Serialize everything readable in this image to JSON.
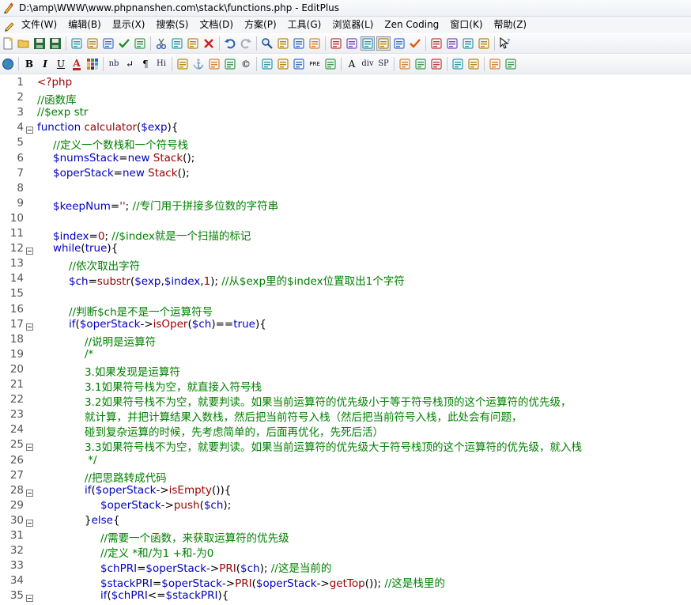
{
  "window": {
    "title": "D:\\amp\\WWW\\www.phpnanshen.com\\stack\\functions.php - EditPlus"
  },
  "menu": [
    {
      "label": "文件(W)"
    },
    {
      "label": "编辑(B)"
    },
    {
      "label": "显示(X)"
    },
    {
      "label": "搜索(S)"
    },
    {
      "label": "文档(D)"
    },
    {
      "label": "方案(P)"
    },
    {
      "label": "工具(G)"
    },
    {
      "label": "浏览器(L)"
    },
    {
      "label": "Zen Coding"
    },
    {
      "label": "窗口(K)"
    },
    {
      "label": "帮助(Z)"
    }
  ],
  "toolbar1": [
    {
      "icon": "new-file-icon"
    },
    {
      "icon": "open-folder-icon"
    },
    {
      "icon": "save-icon"
    },
    {
      "icon": "save-all-icon"
    },
    {
      "sep": true
    },
    {
      "icon": "print-preview-icon"
    },
    {
      "icon": "print-icon"
    },
    {
      "icon": "spell-check-icon"
    },
    {
      "icon": "check-icon"
    },
    {
      "icon": "ftp-upload-icon"
    },
    {
      "sep": true
    },
    {
      "icon": "cut-icon"
    },
    {
      "icon": "copy-icon"
    },
    {
      "icon": "paste-icon"
    },
    {
      "icon": "delete-icon"
    },
    {
      "sep": true
    },
    {
      "icon": "undo-icon"
    },
    {
      "icon": "redo-icon"
    },
    {
      "sep": true
    },
    {
      "icon": "find-icon"
    },
    {
      "icon": "replace-icon"
    },
    {
      "icon": "find-in-files-icon"
    },
    {
      "icon": "goto-line-icon"
    },
    {
      "sep": true
    },
    {
      "icon": "font-icon"
    },
    {
      "icon": "hex-icon"
    },
    {
      "icon": "word-wrap-icon"
    },
    {
      "icon": "line-number-icon"
    },
    {
      "icon": "column-select-icon"
    },
    {
      "icon": "spell-icon"
    },
    {
      "sep": true
    },
    {
      "icon": "window-icon"
    },
    {
      "icon": "tile-icon"
    },
    {
      "icon": "cliptext-icon"
    },
    {
      "icon": "dir-icon"
    },
    {
      "sep": true
    },
    {
      "icon": "help-cursor-icon"
    }
  ],
  "toolbar2": [
    {
      "icon": "globe-icon"
    },
    {
      "sep": true
    },
    {
      "icon": "bold-icon",
      "glyph": "B"
    },
    {
      "icon": "italic-icon",
      "glyph": "I"
    },
    {
      "icon": "underline-icon",
      "glyph": "U"
    },
    {
      "icon": "font-color-icon",
      "glyph": "A"
    },
    {
      "icon": "color-grid-icon"
    },
    {
      "sep": true
    },
    {
      "icon": "nbsp-icon",
      "glyph": "nb"
    },
    {
      "icon": "line-break-icon",
      "glyph": "↵"
    },
    {
      "icon": "paragraph-icon",
      "glyph": "¶"
    },
    {
      "icon": "heading-icon",
      "glyph": "Hi"
    },
    {
      "sep": true
    },
    {
      "icon": "image-icon"
    },
    {
      "icon": "anchor-icon",
      "glyph": "⚓"
    },
    {
      "icon": "hr-icon"
    },
    {
      "icon": "comment-icon"
    },
    {
      "icon": "copyright-icon",
      "glyph": "©"
    },
    {
      "sep": true
    },
    {
      "icon": "table-icon"
    },
    {
      "icon": "table-row-icon"
    },
    {
      "icon": "center-icon"
    },
    {
      "icon": "pre-icon",
      "glyph": "PRE"
    },
    {
      "icon": "list-icon"
    },
    {
      "sep": true
    },
    {
      "icon": "form-icon",
      "glyph": "A"
    },
    {
      "icon": "div-icon",
      "glyph": "div"
    },
    {
      "icon": "span-icon",
      "glyph": "SP"
    },
    {
      "sep": true
    },
    {
      "icon": "edit-icon"
    },
    {
      "icon": "style-icon"
    },
    {
      "icon": "script-icon"
    },
    {
      "sep": true
    },
    {
      "icon": "view-icon"
    },
    {
      "icon": "browser-icon"
    },
    {
      "sep": true
    },
    {
      "icon": "color-picker-icon"
    },
    {
      "icon": "preview-icon"
    }
  ],
  "code": {
    "lines": [
      {
        "n": "1",
        "fold": false,
        "indent": 0,
        "segs": [
          [
            "php",
            "<?php"
          ]
        ]
      },
      {
        "n": "2",
        "fold": false,
        "indent": 0,
        "segs": [
          [
            "cm",
            "//函数库"
          ]
        ]
      },
      {
        "n": "3",
        "fold": false,
        "indent": 0,
        "segs": [
          [
            "cm",
            "//$exp str"
          ]
        ]
      },
      {
        "n": "4",
        "fold": true,
        "indent": 0,
        "segs": [
          [
            "kw",
            "function "
          ],
          [
            "fn",
            "calculator"
          ],
          [
            "txt",
            "("
          ],
          [
            "var",
            "$exp"
          ],
          [
            "txt",
            "){"
          ]
        ]
      },
      {
        "n": "5",
        "fold": false,
        "indent": 1,
        "segs": [
          [
            "cm",
            "//定义一个数栈和一个符号栈"
          ]
        ]
      },
      {
        "n": "6",
        "fold": false,
        "indent": 1,
        "segs": [
          [
            "var",
            "$numsStack"
          ],
          [
            "txt",
            "="
          ],
          [
            "kw",
            "new "
          ],
          [
            "fn",
            "Stack"
          ],
          [
            "txt",
            "();"
          ]
        ]
      },
      {
        "n": "7",
        "fold": false,
        "indent": 1,
        "segs": [
          [
            "var",
            "$operStack"
          ],
          [
            "txt",
            "="
          ],
          [
            "kw",
            "new "
          ],
          [
            "fn",
            "Stack"
          ],
          [
            "txt",
            "();"
          ]
        ]
      },
      {
        "n": "8",
        "fold": false,
        "indent": 0,
        "segs": []
      },
      {
        "n": "9",
        "fold": false,
        "indent": 1,
        "segs": [
          [
            "var",
            "$keepNum"
          ],
          [
            "txt",
            "="
          ],
          [
            "fn",
            "''"
          ],
          [
            "txt",
            "; "
          ],
          [
            "cm",
            "//专门用于拼接多位数的字符串"
          ]
        ]
      },
      {
        "n": "10",
        "fold": false,
        "indent": 0,
        "segs": []
      },
      {
        "n": "11",
        "fold": false,
        "indent": 1,
        "segs": [
          [
            "var",
            "$index"
          ],
          [
            "txt",
            "="
          ],
          [
            "fn",
            "0"
          ],
          [
            "txt",
            "; "
          ],
          [
            "cm",
            "//$index就是一个扫描的标记"
          ]
        ]
      },
      {
        "n": "12",
        "fold": true,
        "indent": 1,
        "segs": [
          [
            "kw",
            "while"
          ],
          [
            "txt",
            "("
          ],
          [
            "kw",
            "true"
          ],
          [
            "txt",
            "){"
          ]
        ]
      },
      {
        "n": "13",
        "fold": false,
        "indent": 2,
        "segs": [
          [
            "cm",
            "//依次取出字符"
          ]
        ]
      },
      {
        "n": "14",
        "fold": false,
        "indent": 2,
        "segs": [
          [
            "var",
            "$ch"
          ],
          [
            "txt",
            "="
          ],
          [
            "fn",
            "substr"
          ],
          [
            "txt",
            "("
          ],
          [
            "var",
            "$exp"
          ],
          [
            "txt",
            ","
          ],
          [
            "var",
            "$index"
          ],
          [
            "txt",
            ","
          ],
          [
            "fn",
            "1"
          ],
          [
            "txt",
            "); "
          ],
          [
            "cm",
            "//从$exp里的$index位置取出1个字符"
          ]
        ]
      },
      {
        "n": "15",
        "fold": false,
        "indent": 0,
        "segs": []
      },
      {
        "n": "16",
        "fold": false,
        "indent": 2,
        "segs": [
          [
            "cm",
            "//判断$ch是不是一个运算符号"
          ]
        ]
      },
      {
        "n": "17",
        "fold": true,
        "indent": 2,
        "segs": [
          [
            "kw",
            "if"
          ],
          [
            "txt",
            "("
          ],
          [
            "var",
            "$operStack"
          ],
          [
            "txt",
            "->"
          ],
          [
            "fn",
            "isOper"
          ],
          [
            "txt",
            "("
          ],
          [
            "var",
            "$ch"
          ],
          [
            "txt",
            ")=="
          ],
          [
            "kw",
            "true"
          ],
          [
            "txt",
            "){"
          ]
        ]
      },
      {
        "n": "18",
        "fold": false,
        "indent": 3,
        "segs": [
          [
            "cm",
            "//说明是运算符"
          ]
        ]
      },
      {
        "n": "19",
        "fold": false,
        "indent": 3,
        "segs": [
          [
            "cm",
            "/*"
          ]
        ]
      },
      {
        "n": "20",
        "fold": false,
        "indent": 3,
        "segs": [
          [
            "cm",
            "3.如果发现是运算符"
          ]
        ]
      },
      {
        "n": "21",
        "fold": false,
        "indent": 3,
        "segs": [
          [
            "cm",
            "3.1如果符号栈为空，就直接入符号栈"
          ]
        ]
      },
      {
        "n": "22",
        "fold": false,
        "indent": 3,
        "segs": [
          [
            "cm",
            "3.2如果符号栈不为空，就要判读。如果当前运算符的优先级小于等于符号栈顶的这个运算符的优先级，"
          ]
        ]
      },
      {
        "n": "23",
        "fold": false,
        "indent": 3,
        "segs": [
          [
            "cm",
            "就计算，并把计算结果入数栈，然后把当前符号入栈（然后把当前符号入栈，此处会有问题，"
          ]
        ]
      },
      {
        "n": "24",
        "fold": false,
        "indent": 3,
        "segs": [
          [
            "cm",
            "碰到复杂运算的时候，先考虑简单的，后面再优化，先死后活）"
          ]
        ]
      },
      {
        "n": "25",
        "fold": true,
        "indent": 3,
        "segs": [
          [
            "cm",
            "3.3如果符号栈不为空，就要判读。如果当前运算符的优先级大于符号栈顶的这个运算符的优先级，就入栈"
          ]
        ]
      },
      {
        "n": "26",
        "fold": false,
        "indent": 3,
        "segs": [
          [
            "cm",
            " */"
          ]
        ]
      },
      {
        "n": "27",
        "fold": false,
        "indent": 3,
        "segs": [
          [
            "cm",
            "//把思路转成代码"
          ]
        ]
      },
      {
        "n": "28",
        "fold": true,
        "indent": 3,
        "segs": [
          [
            "kw",
            "if"
          ],
          [
            "txt",
            "("
          ],
          [
            "var",
            "$operStack"
          ],
          [
            "txt",
            "->"
          ],
          [
            "fn",
            "isEmpty"
          ],
          [
            "txt",
            "()){"
          ]
        ]
      },
      {
        "n": "29",
        "fold": false,
        "indent": 4,
        "segs": [
          [
            "var",
            "$operStack"
          ],
          [
            "txt",
            "->"
          ],
          [
            "fn",
            "push"
          ],
          [
            "txt",
            "("
          ],
          [
            "var",
            "$ch"
          ],
          [
            "txt",
            ");"
          ]
        ]
      },
      {
        "n": "30",
        "fold": true,
        "indent": 3,
        "segs": [
          [
            "txt",
            "}"
          ],
          [
            "kw",
            "else"
          ],
          [
            "txt",
            "{"
          ]
        ]
      },
      {
        "n": "31",
        "fold": false,
        "indent": 4,
        "segs": [
          [
            "cm",
            "//需要一个函数，来获取运算符的优先级"
          ]
        ]
      },
      {
        "n": "32",
        "fold": false,
        "indent": 4,
        "segs": [
          [
            "cm",
            "//定义 *和/为1 +和-为0"
          ]
        ]
      },
      {
        "n": "33",
        "fold": false,
        "indent": 4,
        "segs": [
          [
            "var",
            "$chPRI"
          ],
          [
            "txt",
            "="
          ],
          [
            "var",
            "$operStack"
          ],
          [
            "txt",
            "->"
          ],
          [
            "fn",
            "PRI"
          ],
          [
            "txt",
            "("
          ],
          [
            "var",
            "$ch"
          ],
          [
            "txt",
            "); "
          ],
          [
            "cm",
            "//这是当前的"
          ]
        ]
      },
      {
        "n": "34",
        "fold": false,
        "indent": 4,
        "segs": [
          [
            "var",
            "$stackPRI"
          ],
          [
            "txt",
            "="
          ],
          [
            "var",
            "$operStack"
          ],
          [
            "txt",
            "->"
          ],
          [
            "fn",
            "PRI"
          ],
          [
            "txt",
            "("
          ],
          [
            "var",
            "$operStack"
          ],
          [
            "txt",
            "->"
          ],
          [
            "fn",
            "getTop"
          ],
          [
            "txt",
            "()); "
          ],
          [
            "cm",
            "//这是栈里的"
          ]
        ]
      },
      {
        "n": "35",
        "fold": true,
        "indent": 4,
        "segs": [
          [
            "kw",
            "if"
          ],
          [
            "txt",
            "("
          ],
          [
            "var",
            "$chPRI"
          ],
          [
            "txt",
            "<="
          ],
          [
            "var",
            "$stackPRI"
          ],
          [
            "txt",
            "){"
          ]
        ]
      }
    ]
  }
}
